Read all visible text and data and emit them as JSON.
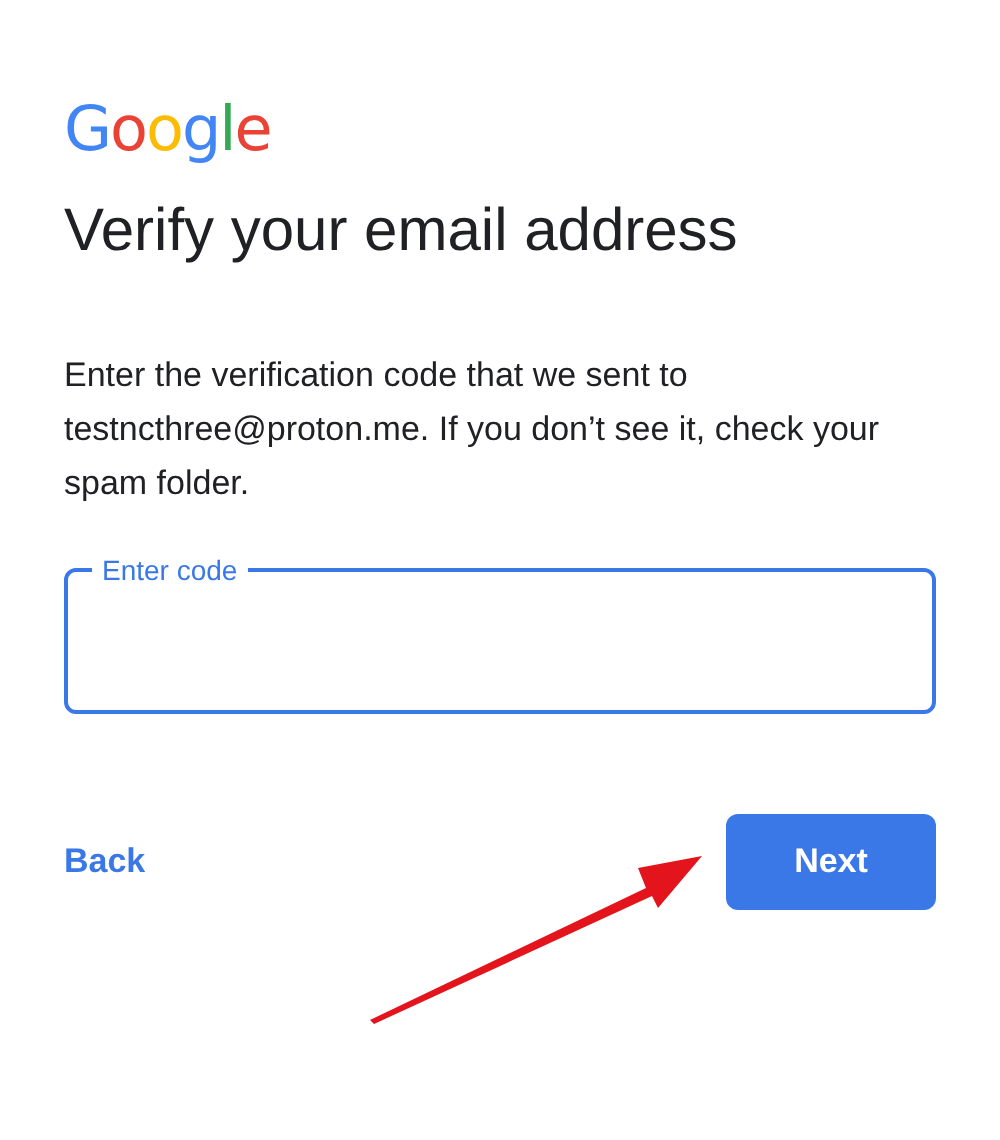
{
  "logo": "Google",
  "title": "Verify your email address",
  "message": "Enter the verification code that we sent to testncthree@proton.me. If you don’t see it, check your spam folder.",
  "code_field": {
    "label": "Enter code",
    "focused": true
  },
  "buttons": {
    "back": "Back",
    "next": "Next"
  }
}
